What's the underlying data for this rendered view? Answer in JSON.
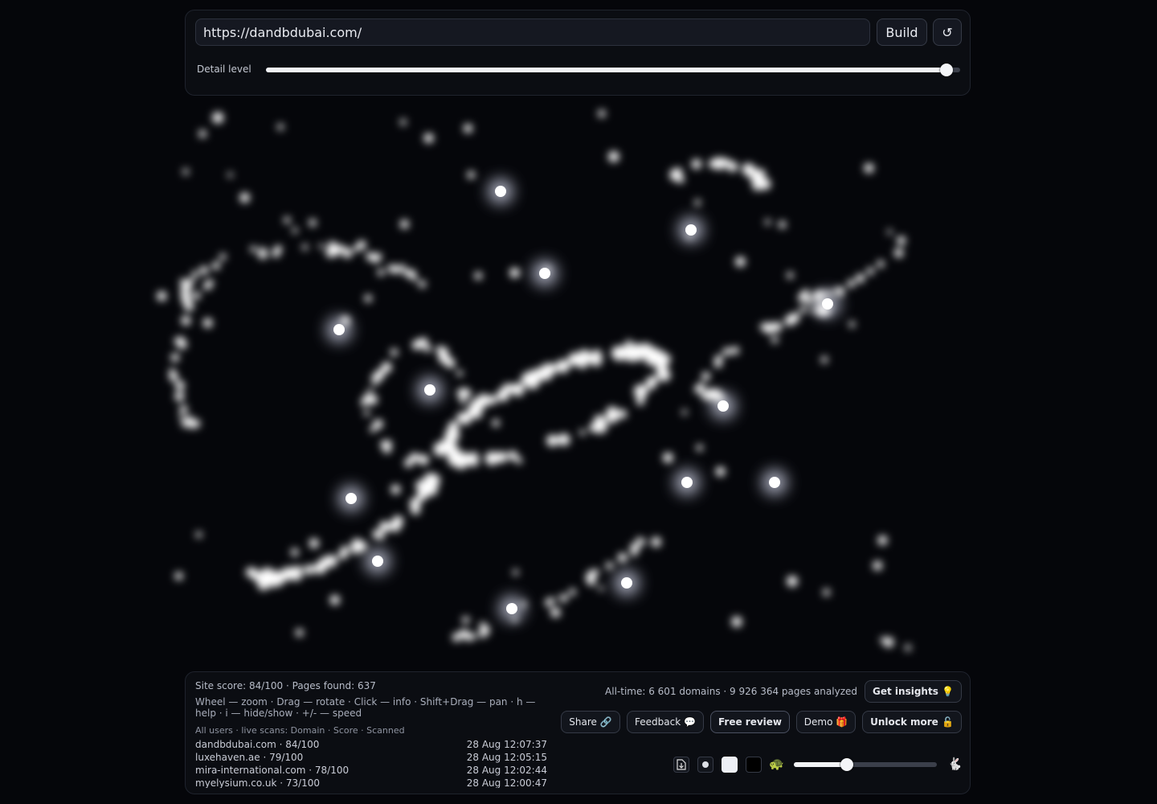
{
  "header": {
    "url_value": "https://dandbdubai.com/",
    "build_label": "Build",
    "reset_icon": "↺",
    "detail_label": "Detail level",
    "detail_level": 0.98
  },
  "footer": {
    "site_score_text": "Site score: 84/100 · Pages found: 637",
    "help_text": "Wheel — zoom · Drag — rotate · Click — info · Shift+Drag — pan · h — help · i — hide/show · +/- — speed",
    "users_header": "All users · live scans: Domain · Score · Scanned",
    "scans": [
      {
        "domain": "dandbdubai.com · 84/100",
        "time": "28 Aug 12:07:37"
      },
      {
        "domain": "luxehaven.ae · 79/100",
        "time": "28 Aug 12:05:15"
      },
      {
        "domain": "mira-international.com · 78/100",
        "time": "28 Aug 12:02:44"
      },
      {
        "domain": "myelysium.co.uk · 73/100",
        "time": "28 Aug 12:00:47"
      }
    ],
    "alltime_text": "All-time: 6 601 domains · 9 926 364 pages analyzed",
    "insights_label": "Get insights 💡",
    "share_label": "Share 🔗",
    "feedback_label": "Feedback 💬",
    "free_review_label": "Free review",
    "demo_label": "Demo 🎁",
    "unlock_label": "Unlock more 🔓",
    "speed_level": 0.37,
    "icons": {
      "export": "download-icon",
      "dot": "dot-icon",
      "white": "white-theme-icon",
      "black": "black-theme-icon",
      "slow": "turtle-icon",
      "fast": "rabbit-icon"
    }
  }
}
